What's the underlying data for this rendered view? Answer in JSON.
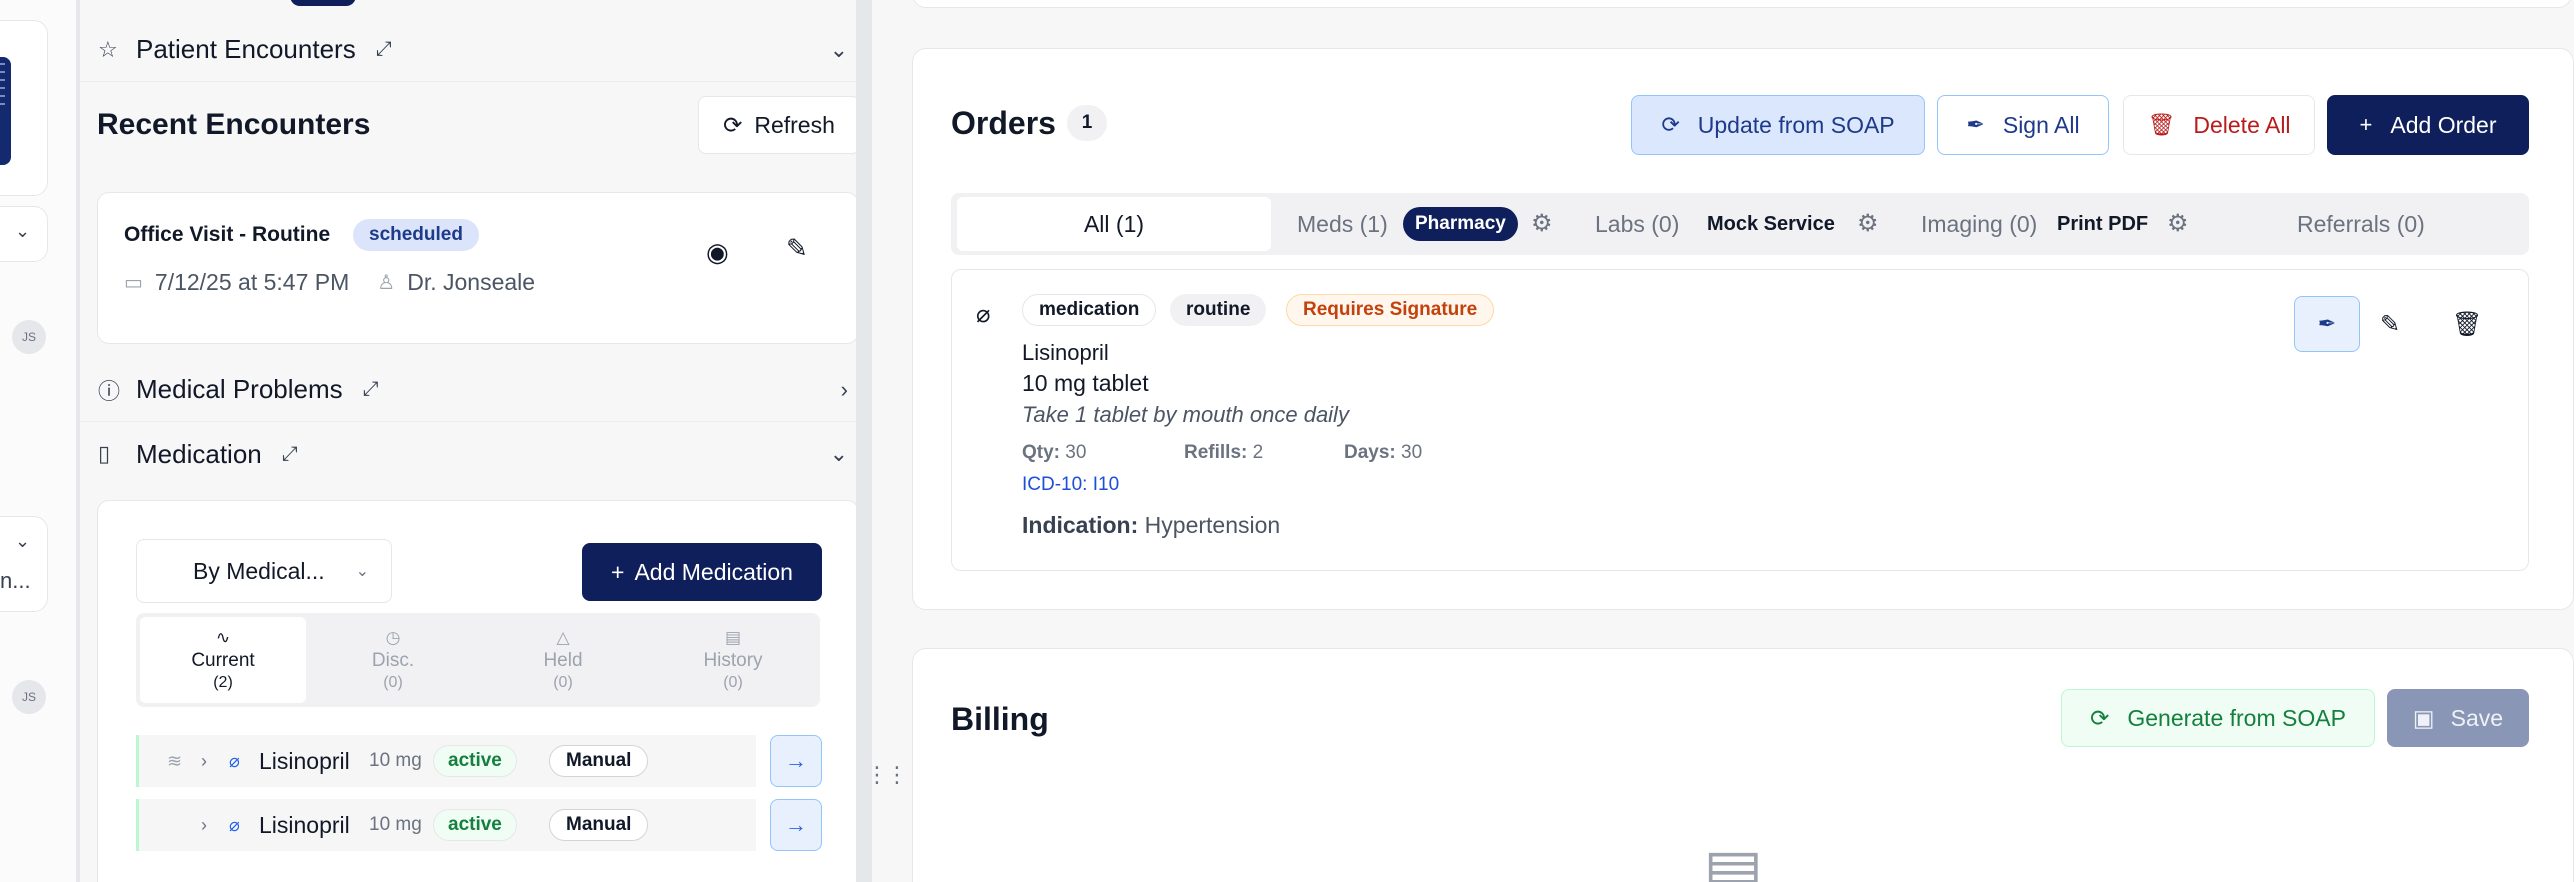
{
  "sidebar": {
    "avatar_initials": "JS",
    "truncated_text": "n..."
  },
  "encounters": {
    "section_title": "Patient Encounters",
    "recent_title": "Recent Encounters",
    "refresh_label": "Refresh",
    "card": {
      "title": "Office Visit - Routine",
      "status": "scheduled",
      "date": "7/12/25 at 5:47 PM",
      "provider": "Dr. Jonseale"
    }
  },
  "problems": {
    "section_title": "Medical Problems"
  },
  "medication": {
    "section_title": "Medication",
    "filter_value": "By Medical...",
    "add_label": "Add Medication",
    "tabs": [
      {
        "label": "Current",
        "count": "(2)"
      },
      {
        "label": "Disc.",
        "count": "(0)"
      },
      {
        "label": "Held",
        "count": "(0)"
      },
      {
        "label": "History",
        "count": "(0)"
      }
    ],
    "rows": [
      {
        "name": "Lisinopril",
        "dose": "10 mg",
        "status": "active",
        "source": "Manual"
      },
      {
        "name": "Lisinopril",
        "dose": "10 mg",
        "status": "active",
        "source": "Manual"
      }
    ]
  },
  "orders": {
    "title": "Orders",
    "count": "1",
    "buttons": {
      "update": "Update from SOAP",
      "sign_all": "Sign All",
      "delete_all": "Delete All",
      "add": "Add Order"
    },
    "tabs": {
      "all": "All (1)",
      "meds": "Meds (1)",
      "meds_service": "Pharmacy",
      "labs": "Labs (0)",
      "labs_service": "Mock Service",
      "imaging": "Imaging (0)",
      "imaging_service": "Print PDF",
      "referrals": "Referrals (0)"
    },
    "item": {
      "type": "medication",
      "priority": "routine",
      "signature": "Requires Signature",
      "name": "Lisinopril",
      "dose": "10 mg tablet",
      "sig": "Take 1 tablet by mouth once daily",
      "qty_label": "Qty:",
      "qty": "30",
      "refills_label": "Refills:",
      "refills": "2",
      "days_label": "Days:",
      "days": "30",
      "icd": "ICD-10: I10",
      "indication_label": "Indication:",
      "indication": "Hypertension"
    }
  },
  "billing": {
    "title": "Billing",
    "generate_label": "Generate from SOAP",
    "save_label": "Save"
  },
  "colors": {
    "brand_navy": "#0f1f5c",
    "active_green": "#15803d",
    "danger_red": "#b91c1c",
    "warning_orange": "#c2410c",
    "link_blue": "#1d4ed8"
  }
}
